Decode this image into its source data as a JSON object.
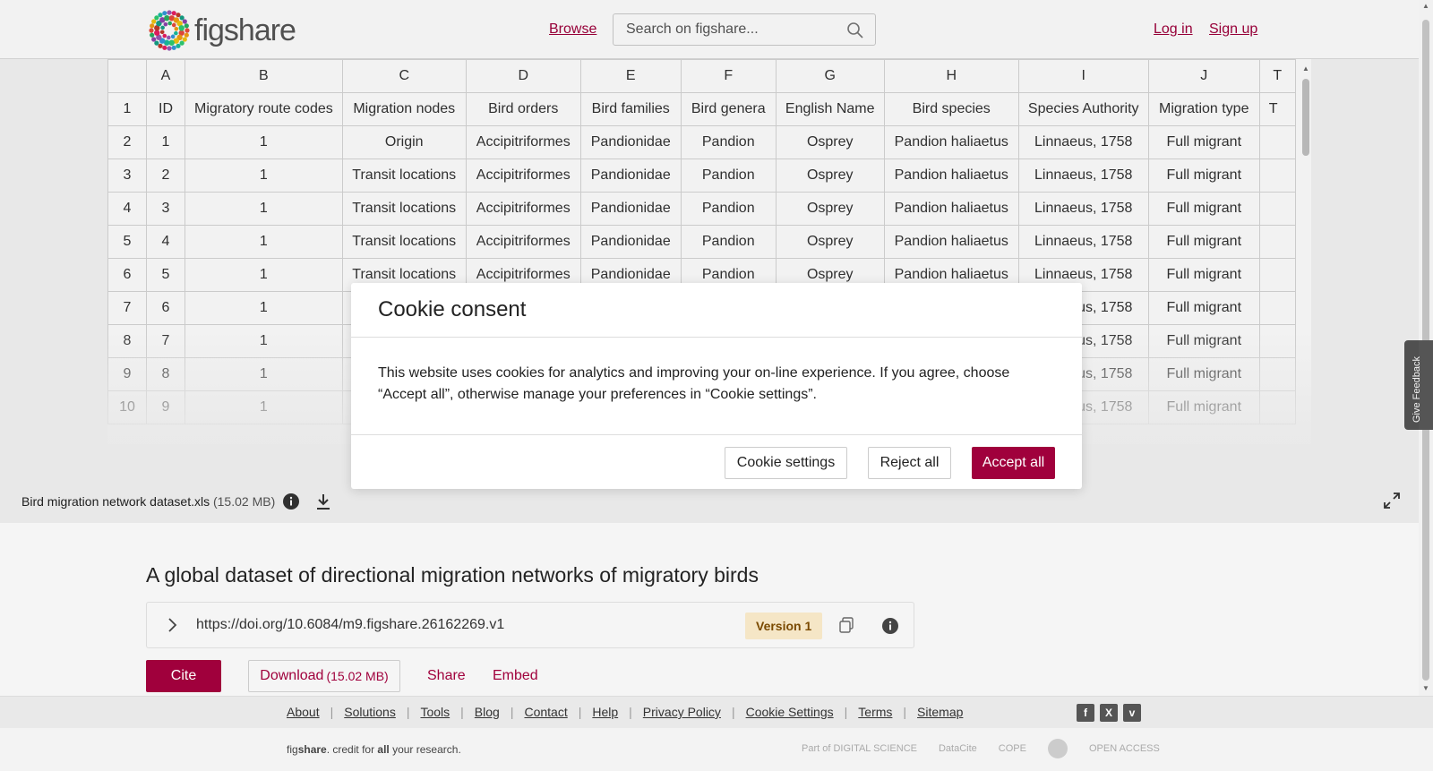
{
  "header": {
    "logo_text": "figshare",
    "browse": "Browse",
    "search_placeholder": "Search on figshare...",
    "login": "Log in",
    "signup": "Sign up"
  },
  "sheet": {
    "col_letters": [
      "",
      "A",
      "B",
      "C",
      "D",
      "E",
      "F",
      "G",
      "H",
      "I",
      "J",
      "T"
    ],
    "rows": [
      [
        "1",
        "ID",
        "Migratory route codes",
        "Migration nodes",
        "Bird orders",
        "Bird families",
        "Bird genera",
        "English Name",
        "Bird species",
        "Species Authority",
        "Migration type",
        "T"
      ],
      [
        "2",
        "1",
        "1",
        "Origin",
        "Accipitriformes",
        "Pandionidae",
        "Pandion",
        "Osprey",
        "Pandion haliaetus",
        "Linnaeus, 1758",
        "Full migrant",
        ""
      ],
      [
        "3",
        "2",
        "1",
        "Transit locations",
        "Accipitriformes",
        "Pandionidae",
        "Pandion",
        "Osprey",
        "Pandion haliaetus",
        "Linnaeus, 1758",
        "Full migrant",
        ""
      ],
      [
        "4",
        "3",
        "1",
        "Transit locations",
        "Accipitriformes",
        "Pandionidae",
        "Pandion",
        "Osprey",
        "Pandion haliaetus",
        "Linnaeus, 1758",
        "Full migrant",
        ""
      ],
      [
        "5",
        "4",
        "1",
        "Transit locations",
        "Accipitriformes",
        "Pandionidae",
        "Pandion",
        "Osprey",
        "Pandion haliaetus",
        "Linnaeus, 1758",
        "Full migrant",
        ""
      ],
      [
        "6",
        "5",
        "1",
        "Transit locations",
        "Accipitriformes",
        "Pandionidae",
        "Pandion",
        "Osprey",
        "Pandion haliaetus",
        "Linnaeus, 1758",
        "Full migrant",
        ""
      ],
      [
        "7",
        "6",
        "1",
        "",
        "",
        "",
        "",
        "",
        "",
        "Linnaeus, 1758",
        "Full migrant",
        ""
      ],
      [
        "8",
        "7",
        "1",
        "",
        "",
        "",
        "",
        "",
        "",
        "Linnaeus, 1758",
        "Full migrant",
        ""
      ],
      [
        "9",
        "8",
        "1",
        "",
        "",
        "",
        "",
        "",
        "",
        "Linnaeus, 1758",
        "Full migrant",
        ""
      ],
      [
        "10",
        "9",
        "1",
        "",
        "",
        "",
        "",
        "",
        "",
        "Linnaeus, 1758",
        "Full migrant",
        ""
      ]
    ]
  },
  "file": {
    "name": "Bird migration network dataset.xls",
    "size": "(15.02 MB)"
  },
  "item": {
    "title": "A global dataset of directional migration networks of migratory birds",
    "doi": "https://doi.org/10.6084/m9.figshare.26162269.v1",
    "version": "Version 1",
    "cite": "Cite",
    "download": "Download",
    "download_size": "(15.02 MB)",
    "share": "Share",
    "embed": "Embed"
  },
  "feedback": "Give Feedback",
  "cookie": {
    "title": "Cookie consent",
    "body": "This website uses cookies for analytics and improving your on-line experience. If you agree, choose “Accept all”, otherwise manage your preferences in “Cookie settings”.",
    "settings": "Cookie settings",
    "reject": "Reject all",
    "accept": "Accept all"
  },
  "footer": {
    "links": [
      "About",
      "Solutions",
      "Tools",
      "Blog",
      "Contact",
      "Help",
      "Privacy Policy",
      "Cookie Settings",
      "Terms",
      "Sitemap"
    ],
    "tagline_pre": "fig",
    "tagline_brand": "share",
    "tagline_mid": ". credit for ",
    "tagline_all": "all",
    "tagline_post": " your research.",
    "partners": [
      "Part of DIGITAL SCIENCE",
      "DataCite",
      "COPE",
      "",
      "OPEN ACCESS"
    ]
  },
  "colors": {
    "brand": "#a0003c",
    "version_bg": "#f5e6c6"
  }
}
